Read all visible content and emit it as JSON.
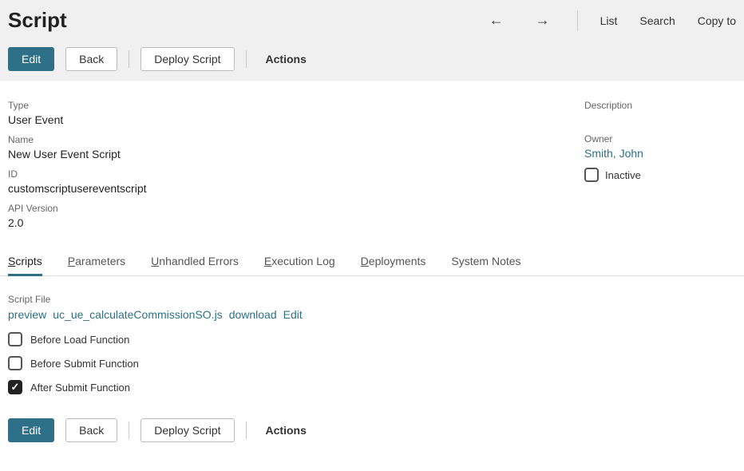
{
  "header": {
    "title": "Script",
    "nav": {
      "list": "List",
      "search": "Search",
      "copyTo": "Copy to"
    }
  },
  "toolbar": {
    "edit": "Edit",
    "back": "Back",
    "deploy": "Deploy Script",
    "actions": "Actions"
  },
  "fields": {
    "type": {
      "label": "Type",
      "value": "User Event"
    },
    "name": {
      "label": "Name",
      "value": "New User Event Script"
    },
    "id": {
      "label": "ID",
      "value": "customscriptusereventscript"
    },
    "apiVersion": {
      "label": "API Version",
      "value": "2.0"
    },
    "description": {
      "label": "Description"
    },
    "owner": {
      "label": "Owner",
      "value": "Smith, John"
    },
    "inactive": {
      "label": "Inactive",
      "checked": false
    }
  },
  "tabs": {
    "scripts": "Scripts",
    "parameters": "Parameters",
    "unhandled": "Unhandled Errors",
    "execution": "Execution Log",
    "deployments": "Deployments",
    "systemNotes": "System Notes"
  },
  "scriptFile": {
    "label": "Script File",
    "preview": "preview",
    "filename": "uc_ue_calculateCommissionSO.js",
    "download": "download",
    "edit": "Edit"
  },
  "functions": {
    "beforeLoad": {
      "label": "Before Load Function",
      "checked": false
    },
    "beforeSubmit": {
      "label": "Before Submit Function",
      "checked": false
    },
    "afterSubmit": {
      "label": "After Submit Function",
      "checked": true
    }
  }
}
